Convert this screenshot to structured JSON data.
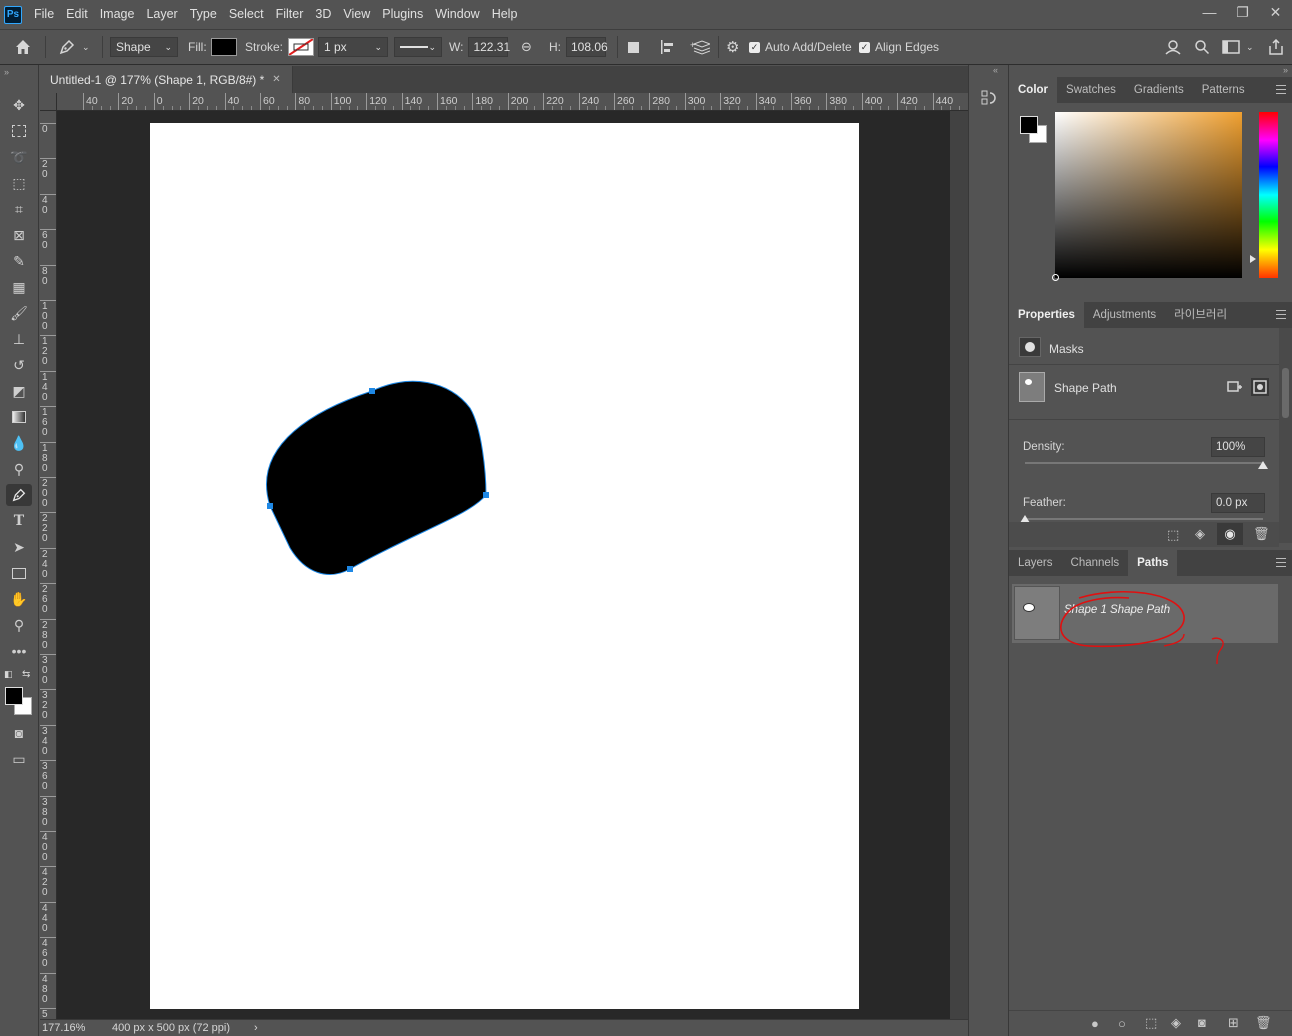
{
  "app": {
    "logo_text": "Ps",
    "menu": [
      "File",
      "Edit",
      "Image",
      "Layer",
      "Type",
      "Select",
      "Filter",
      "3D",
      "View",
      "Plugins",
      "Window",
      "Help"
    ]
  },
  "window_controls": {
    "minimize": "—",
    "maximize": "❐",
    "close": "✕"
  },
  "options_bar": {
    "mode_value": "Shape",
    "fill_label": "Fill:",
    "stroke_label": "Stroke:",
    "stroke_width_value": "1 px",
    "width_label": "W:",
    "width_value": "122.31",
    "height_label": "H:",
    "height_value": "108.06",
    "auto_add_delete_label": "Auto Add/Delete",
    "align_edges_label": "Align Edges"
  },
  "document": {
    "tab_title": "Untitled-1 @ 177% (Shape 1, RGB/8#) *",
    "ruler_top_labels": [
      "40",
      "20",
      "0",
      "20",
      "40",
      "60",
      "80",
      "100",
      "120",
      "140",
      "160",
      "180",
      "200",
      "220",
      "240",
      "260",
      "280",
      "300",
      "320",
      "340",
      "360",
      "380",
      "400",
      "420",
      "440"
    ],
    "ruler_left_labels": [
      "0",
      "20",
      "40",
      "60",
      "80",
      "100",
      "120",
      "140",
      "160",
      "180",
      "200",
      "220",
      "240",
      "260",
      "280",
      "300",
      "320",
      "340",
      "360",
      "380",
      "400",
      "420",
      "440",
      "460",
      "480",
      "500"
    ],
    "zoom": "177.16%",
    "doc_info": "400 px x 500 px (72 ppi)"
  },
  "color_panel": {
    "tabs": [
      "Color",
      "Swatches",
      "Gradients",
      "Patterns"
    ],
    "foreground": "#000000",
    "background": "#ffffff"
  },
  "properties_panel": {
    "tabs": [
      "Properties",
      "Adjustments",
      "라이브러리"
    ],
    "masks_label": "Masks",
    "shape_path_label": "Shape Path",
    "density_label": "Density:",
    "density_value": "100%",
    "density_fraction": 1.0,
    "feather_label": "Feather:",
    "feather_value": "0.0 px",
    "feather_fraction": 0.0
  },
  "paths_panel": {
    "tabs": [
      "Layers",
      "Channels",
      "Paths"
    ],
    "items": [
      {
        "name": "Shape 1 Shape Path"
      }
    ]
  },
  "colors": {
    "ui_bg": "#535353",
    "canvas_bg": "#282828",
    "selection_blue": "#1e88e5",
    "annotation_red": "#e01010"
  }
}
